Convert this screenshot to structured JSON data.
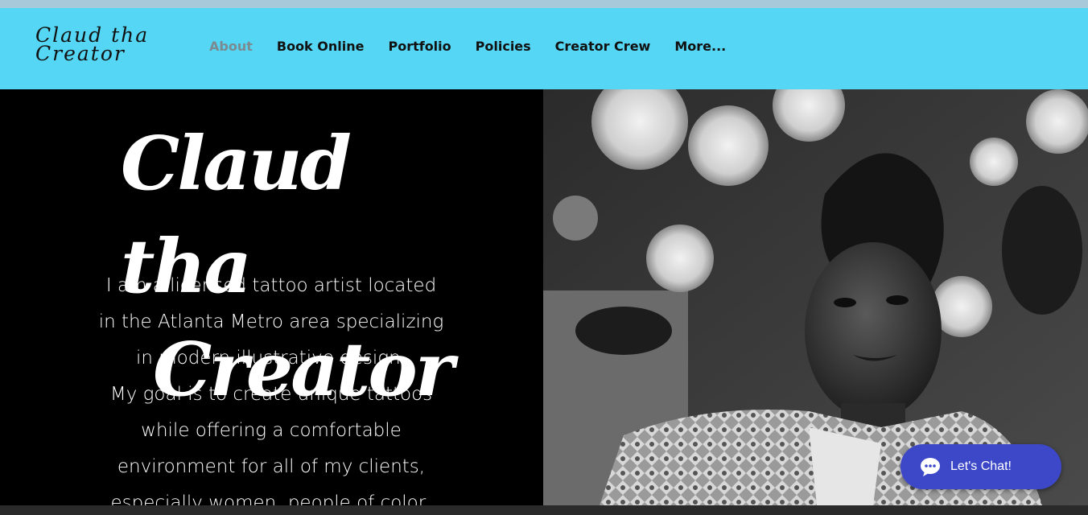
{
  "header": {
    "logo_line1": "Claud tha",
    "logo_line2": "Creator",
    "nav": [
      {
        "label": "About"
      },
      {
        "label": "Book Online"
      },
      {
        "label": "Portfolio"
      },
      {
        "label": "Policies"
      },
      {
        "label": "Creator Crew"
      },
      {
        "label": "More..."
      }
    ],
    "active_nav": "About"
  },
  "hero": {
    "title_line1": "Claud tha",
    "title_line2": "Creator",
    "bio_lines": [
      "I am a licensed tattoo artist located",
      "in the Atlanta Metro area specializing",
      "in modern illustrative design.",
      "My goal is to create unique tattoos",
      "while offering a comfortable",
      "environment for all of my clients,",
      "especially women, people of color,"
    ]
  },
  "chat": {
    "label": "Let's Chat!",
    "icon": "chat-bubble-icon"
  },
  "colors": {
    "header_bg": "#54d6f4",
    "hero_bg": "#000000",
    "chat_bg": "#3c48c8",
    "active_nav": "#7b8a90"
  }
}
